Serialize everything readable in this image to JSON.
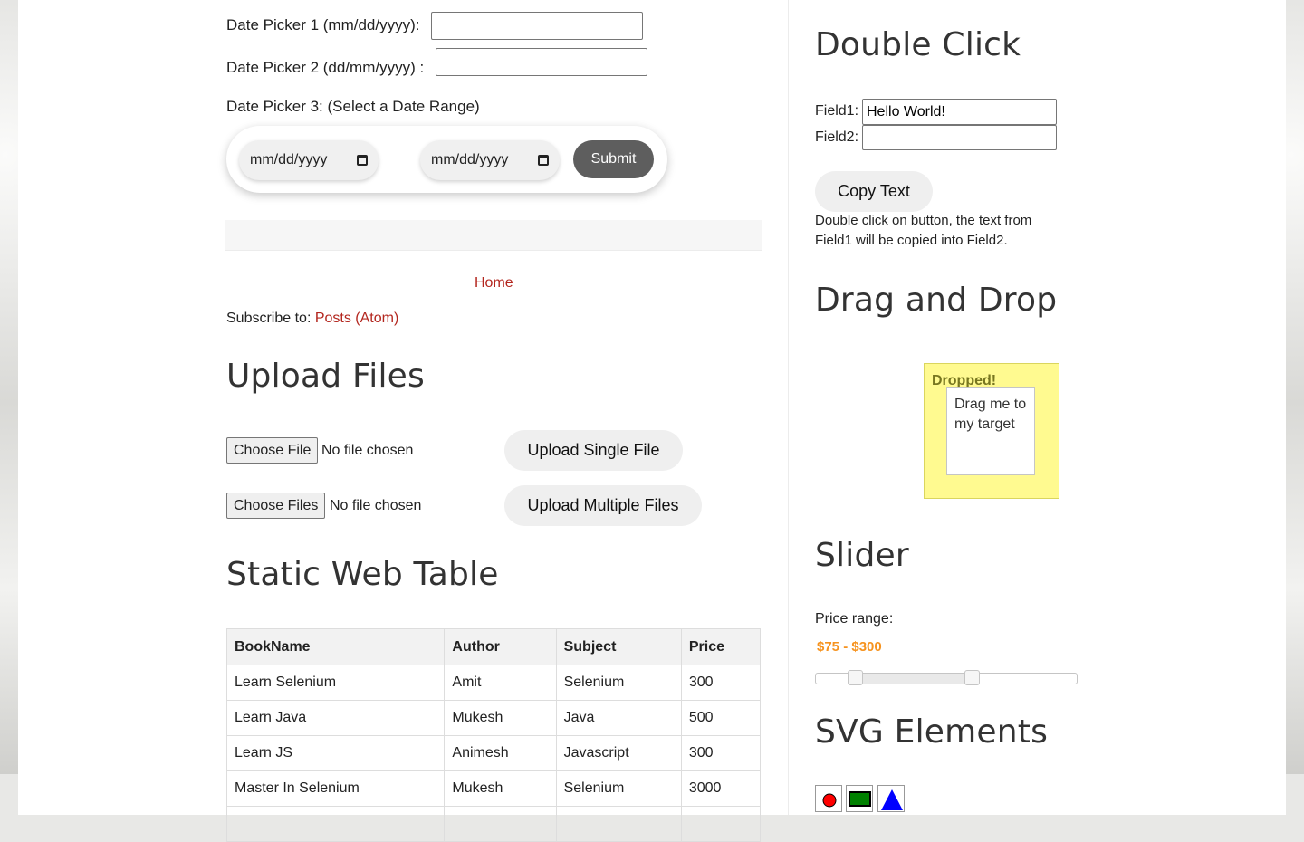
{
  "date_pickers": {
    "picker1_label": "Date Picker 1 (mm/dd/yyyy):",
    "picker2_label": "Date Picker 2 (dd/mm/yyyy) :",
    "picker3_label": "Date Picker 3: (Select a Date Range)",
    "start_placeholder": "mm/dd/yyyy",
    "end_placeholder": "mm/dd/yyyy",
    "submit_label": "Submit"
  },
  "footer_nav": {
    "home_link": "Home",
    "subscribe_prefix": "Subscribe to:",
    "subscribe_link": "Posts (Atom)"
  },
  "upload": {
    "title": "Upload Files",
    "single_choose_label": "Choose File",
    "single_status": "No file chosen",
    "single_button": "Upload Single File",
    "multi_choose_label": "Choose Files",
    "multi_status": "No file chosen",
    "multi_button": "Upload Multiple Files"
  },
  "static_table": {
    "title": "Static Web Table",
    "headers": [
      "BookName",
      "Author",
      "Subject",
      "Price"
    ],
    "rows": [
      [
        "Learn Selenium",
        "Amit",
        "Selenium",
        "300"
      ],
      [
        "Learn Java",
        "Mukesh",
        "Java",
        "500"
      ],
      [
        "Learn JS",
        "Animesh",
        "Javascript",
        "300"
      ],
      [
        "Master In Selenium",
        "Mukesh",
        "Selenium",
        "3000"
      ]
    ]
  },
  "double_click": {
    "title": "Double Click",
    "field1_label": "Field1:",
    "field1_value": "Hello World!",
    "field2_label": "Field2:",
    "field2_value": "",
    "button_label": "Copy Text",
    "description": "Double click on button, the text from Field1 will be copied into Field2."
  },
  "drag_drop": {
    "title": "Drag and Drop",
    "drop_label": "Dropped!",
    "drag_label": "Drag me to my target"
  },
  "slider": {
    "title": "Slider",
    "label": "Price range:",
    "range_text": "$75 - $300",
    "min_value": 75,
    "max_value": 300,
    "range_color": "#f6931f"
  },
  "svg_elements": {
    "title": "SVG Elements",
    "shapes": [
      "red-circle-icon",
      "green-rectangle-icon",
      "blue-triangle-icon"
    ],
    "colors": {
      "circle": "#ff0000",
      "rectangle": "#008000",
      "triangle": "#0000ff"
    }
  }
}
